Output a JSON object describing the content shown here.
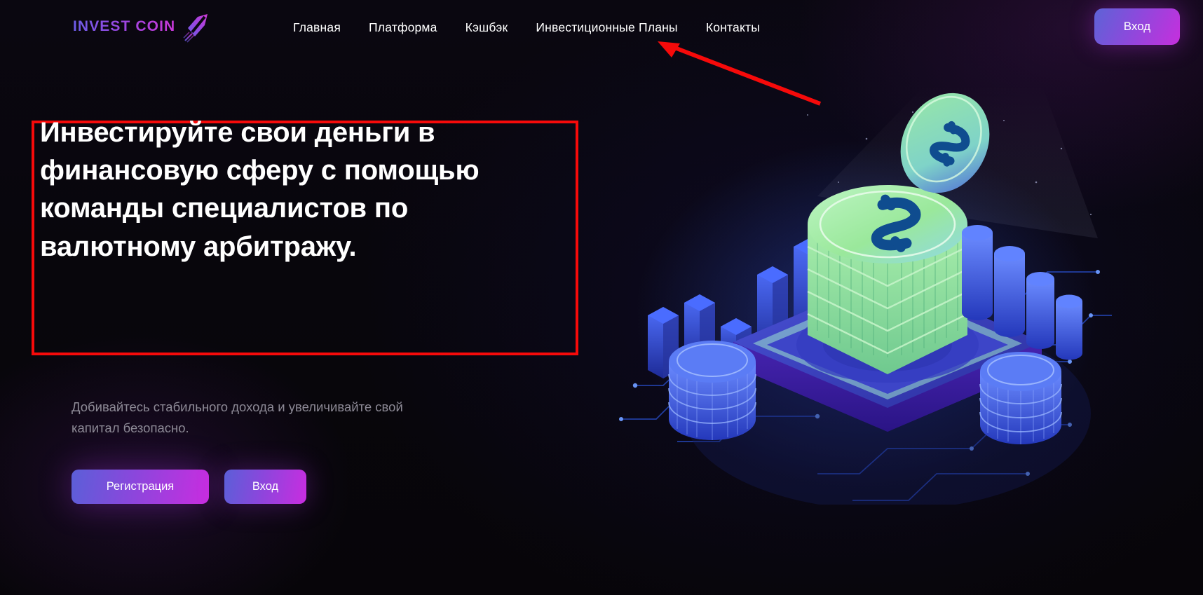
{
  "brand": {
    "name": "INVEST COIN",
    "logo_icon": "arrow-up-right-logo-icon",
    "gradient_start": "#6b5ce7",
    "gradient_end": "#c838d8"
  },
  "nav": {
    "items": [
      {
        "label": "Главная"
      },
      {
        "label": "Платформа"
      },
      {
        "label": "Кэшбэк"
      },
      {
        "label": "Инвестиционные Планы"
      },
      {
        "label": "Контакты"
      }
    ]
  },
  "header": {
    "login_label": "Вход"
  },
  "hero": {
    "headline": "Инвестируйте свои деньги в финансовую сферу с помощью команды специалистов по валютному арбитражу.",
    "subtitle": "Добивайтесь стабильного дохода и увеличивайте свой капитал безопасно.",
    "primary_cta": "Регистрация",
    "secondary_cta": "Вход"
  },
  "annotations": {
    "highlight_box_color": "#f60a0a",
    "arrow_color": "#f60a0a",
    "arrow_target": "Инвестиционные Планы"
  },
  "illustration": {
    "name": "isometric-coin-platform-illustration",
    "coin_color": "#9ae89b",
    "platform_color": "#3b40c4",
    "bar_color": "#3a5cf0",
    "currency_symbol": "$",
    "left_bars": [
      78,
      96,
      64,
      136,
      168
    ],
    "right_bars": [
      104,
      86,
      62,
      44
    ]
  },
  "colors": {
    "background": "#08060c",
    "accent_purple": "#8b4adc",
    "accent_magenta": "#c62fdd",
    "nav_text": "#ffffff",
    "muted_text": "#8d8a96"
  }
}
